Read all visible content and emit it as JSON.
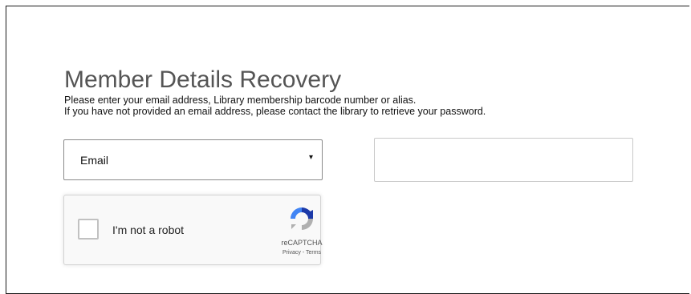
{
  "page": {
    "title": "Member Details Recovery",
    "instructions": [
      "Please enter your email address, Library membership barcode number or alias.",
      "If you have not provided an email address, please contact the library to retrieve your password."
    ]
  },
  "form": {
    "lookup_type": {
      "selected": "Email",
      "arrow": "▾"
    },
    "lookup_value": {
      "value": "",
      "placeholder": ""
    }
  },
  "captcha": {
    "label": "I'm not a robot",
    "brand": "reCAPTCHA",
    "links": "Privacy - Terms",
    "logo_icon": "recaptcha-logo-icon",
    "colors": {
      "blue_dark": "#1c3aa9",
      "blue_light": "#4285f4",
      "gray": "#b0b0b0"
    }
  }
}
